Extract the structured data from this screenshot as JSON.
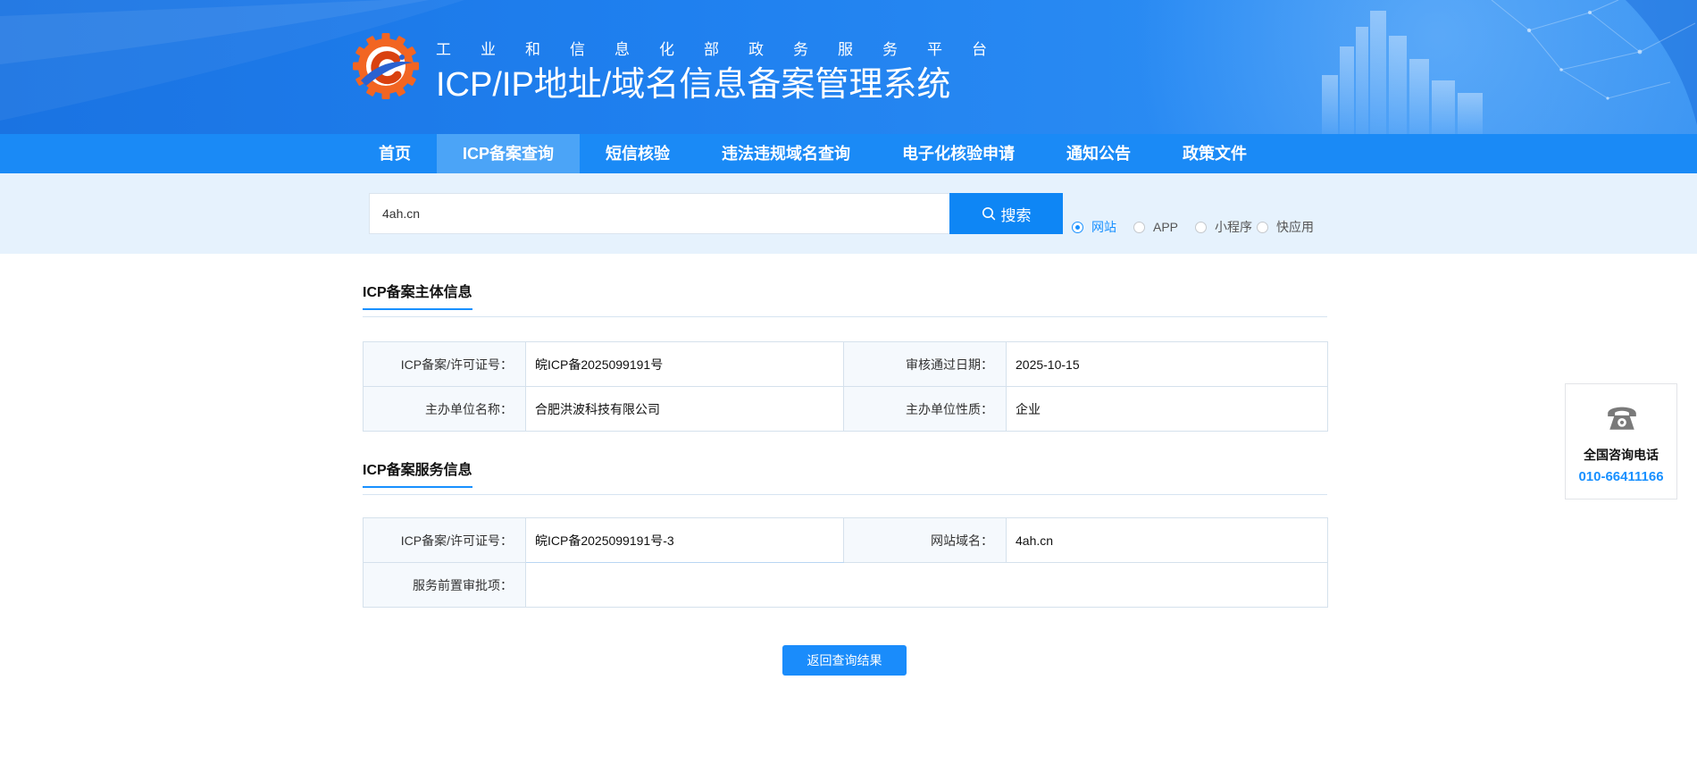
{
  "header": {
    "logo_icon": "gear-emblem-logo",
    "subtitle": "工业和信息化部政务服务平台",
    "title": "ICP/IP地址/域名信息备案管理系统"
  },
  "nav": {
    "items": [
      {
        "label": "首页",
        "active": false
      },
      {
        "label": "ICP备案查询",
        "active": true
      },
      {
        "label": "短信核验",
        "active": false
      },
      {
        "label": "违法违规域名查询",
        "active": false
      },
      {
        "label": "电子化核验申请",
        "active": false
      },
      {
        "label": "通知公告",
        "active": false
      },
      {
        "label": "政策文件",
        "active": false
      }
    ]
  },
  "search": {
    "value": "4ah.cn",
    "button_label": "搜索",
    "button_icon": "search-icon",
    "types": [
      {
        "label": "网站",
        "selected": true
      },
      {
        "label": "APP",
        "selected": false
      },
      {
        "label": "小程序",
        "selected": false
      },
      {
        "label": "快应用",
        "selected": false
      }
    ]
  },
  "subject_info": {
    "title": "ICP备案主体信息",
    "fields": [
      {
        "label": "ICP备案/许可证号：",
        "value": "皖ICP备2025099191号"
      },
      {
        "label": "审核通过日期：",
        "value": "2025-10-15"
      },
      {
        "label": "主办单位名称：",
        "value": "合肥洪波科技有限公司"
      },
      {
        "label": "主办单位性质：",
        "value": "企业"
      }
    ]
  },
  "service_info": {
    "title": "ICP备案服务信息",
    "fields": [
      {
        "label": "ICP备案/许可证号：",
        "value": "皖ICP备2025099191号-3"
      },
      {
        "label": "网站域名：",
        "value": "4ah.cn"
      },
      {
        "label": "服务前置审批项：",
        "value": ""
      }
    ]
  },
  "actions": {
    "back_label": "返回查询结果"
  },
  "hotline": {
    "icon": "phone-icon",
    "label": "全国咨询电话",
    "number": "010-66411166"
  },
  "colors": {
    "brand_blue": "#1890ff",
    "nav_bg": "#1a8af6",
    "nav_active_bg": "#4ba4f7",
    "search_band_bg": "#e6f2fd",
    "button_blue": "#0e86f5",
    "hotline_blue": "#1890ff",
    "logo_orange": "#f26522"
  }
}
